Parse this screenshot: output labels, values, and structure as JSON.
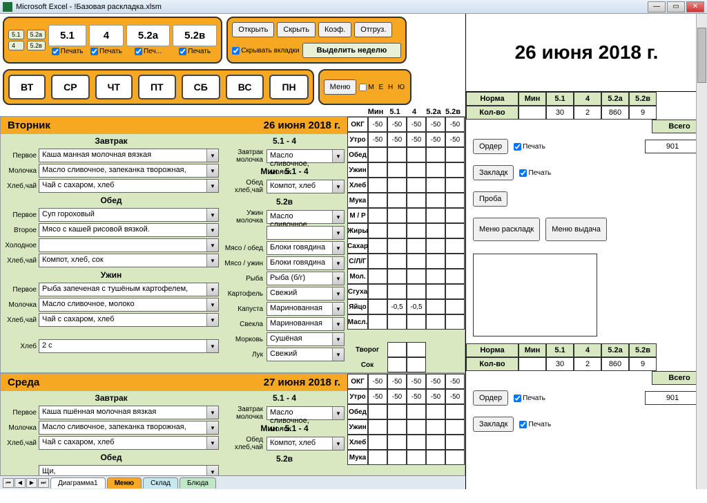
{
  "window": {
    "title": "Microsoft Excel - !Базовая раскладка.xlsm"
  },
  "top": {
    "small": [
      "5.1",
      "5.2а",
      "4",
      "5.2в"
    ],
    "vals": [
      "5.1",
      "4",
      "5.2а",
      "5.2в"
    ],
    "print": "Печать",
    "print_short": "Печ...",
    "actions": {
      "open": "Открыть",
      "hide": "Скрыть",
      "coef": "Коэф.",
      "ship": "Отгруз.",
      "hide_tabs": "Скрывать вкладки",
      "select_week": "Выделить неделю"
    },
    "days": [
      "ВТ",
      "СР",
      "ЧТ",
      "ПТ",
      "СБ",
      "ВС",
      "ПН"
    ],
    "menu_btn": "Меню",
    "menu_cb": "М Е Н Ю"
  },
  "minhdr": {
    "l": "Мин",
    "c": [
      "5.1",
      "4",
      "5.2а",
      "5.2в"
    ]
  },
  "bigdate": "26 июня 2018 г.",
  "norm": {
    "h": [
      "Норма",
      "Мин",
      "5.1",
      "4",
      "5.2а",
      "5.2в"
    ],
    "r": [
      "Кол-во",
      "",
      "30",
      "2",
      "860",
      "9"
    ],
    "total": "Всего",
    "total_v": "901",
    "b": {
      "order": "Ордер",
      "zaklad": "Закладк",
      "proba": "Проба",
      "mr": "Меню раскладк",
      "mv": "Меню выдача"
    },
    "print": "Печать"
  },
  "days": [
    {
      "name": "Вторник",
      "date": "26 июня 2018 г.",
      "left": {
        "breakfast": {
          "t": "Завтрак",
          "sec": "5.1 - 4",
          "rows": [
            [
              "Первое",
              "Каша манная молочная вязкая"
            ],
            [
              "Молочка",
              "Масло сливочное, запеканка творожная,"
            ],
            [
              "Хлеб,чай",
              "Чай с сахаром, хлеб"
            ]
          ]
        },
        "lunch": {
          "t": "Обед",
          "rows": [
            [
              "Первое",
              "Суп гороховый"
            ],
            [
              "Второе",
              "Мясо с кашей рисовой вязкой."
            ],
            [
              "Холодное",
              ""
            ],
            [
              "Хлеб,чай",
              "Компот, хлеб, сок"
            ]
          ]
        },
        "dinner": {
          "t": "Ужин",
          "rows": [
            [
              "Первое",
              "Рыба запеченая с тушёным картофелем,"
            ],
            [
              "Молочка",
              "Масло сливочное, молоко"
            ],
            [
              "Хлеб,чай",
              "Чай с сахаром, хлеб"
            ]
          ]
        },
        "bread": [
          "Хлеб",
          "2 с"
        ]
      },
      "right": {
        "brk": [
          [
            "Завтрак молочка",
            "Масло сливочное, молок"
          ]
        ],
        "min": "Мин - 5.1 - 4",
        "obed": [
          [
            "Обед хлеб,чай",
            "Компот, хлеб"
          ]
        ],
        "s52": "5.2в",
        "din": [
          [
            "Ужин молочка",
            "Масло сливочное"
          ],
          [
            "",
            ""
          ],
          [
            "Мясо / обед",
            "Блоки говядина"
          ],
          [
            "Мясо / ужин",
            "Блоки говядина"
          ],
          [
            "Рыба",
            "Рыба (б/г)"
          ],
          [
            "Картофель",
            "Свежий"
          ],
          [
            "Капуста",
            "Маринованная"
          ],
          [
            "Свекла",
            "Маринованная"
          ],
          [
            "Морковь",
            "Сушёная"
          ],
          [
            "Лук",
            "Свежий"
          ]
        ]
      }
    },
    {
      "name": "Среда",
      "date": "27 июня 2018 г.",
      "left": {
        "breakfast": {
          "t": "Завтрак",
          "sec": "5.1 - 4",
          "rows": [
            [
              "Первое",
              "Каша пшённая молочная вязкая"
            ],
            [
              "Молочка",
              "Масло сливочное, запеканка творожная,"
            ],
            [
              "Хлеб,чай",
              "Чай с сахаром, хлеб"
            ]
          ]
        },
        "lunch": {
          "t": "Обед",
          "rows": [
            [
              "",
              "Щи,"
            ]
          ]
        }
      },
      "right": {
        "brk": [
          [
            "Завтрак молочка",
            "Масло сливочное, молок"
          ]
        ],
        "min": "Мин - 5.1 - 4",
        "obed": [
          [
            "Обед хлеб,чай",
            "Компот, хлеб"
          ]
        ],
        "s52": "5.2в"
      }
    }
  ],
  "nut": {
    "labels": [
      "ОКГ",
      "Утро",
      "Обед",
      "Ужин",
      "Хлеб",
      "Мука",
      "М / Р",
      "Жиры",
      "Сахар",
      "С/Л/Г",
      "Мол.",
      "Сгуха",
      "Яйцо",
      "Масл.",
      "",
      "Творог",
      "Сок"
    ],
    "okg": [
      "-50",
      "-50",
      "-50",
      "-50",
      "-50"
    ],
    "utro": [
      "-50",
      "-50",
      "-50",
      "-50",
      "-50"
    ],
    "egg": [
      "",
      "-0,5",
      "-0,5",
      "",
      ""
    ]
  },
  "tabs": {
    "items": [
      "Диаграмма1",
      "Меню",
      "Склад",
      "Блюда"
    ],
    "active": 1
  }
}
